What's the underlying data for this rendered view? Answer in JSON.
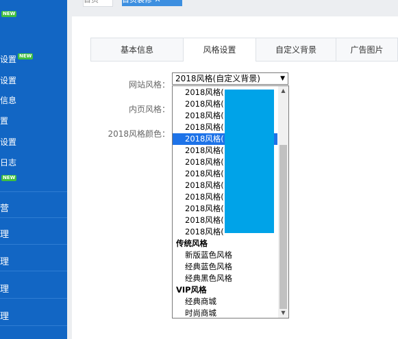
{
  "sidebar": {
    "new_badge": "NEW",
    "items": [
      {
        "label": "设置"
      },
      {
        "label": "设置"
      },
      {
        "label": "信息"
      },
      {
        "label": "置"
      },
      {
        "label": "设置"
      },
      {
        "label": "日志"
      },
      {
        "label": "营"
      },
      {
        "label": "理"
      },
      {
        "label": "理"
      },
      {
        "label": "理"
      },
      {
        "label": "理"
      }
    ]
  },
  "topbar": {
    "home_tab": "首页",
    "active_tab": "首页装修 ✕"
  },
  "tabs": [
    "基本信息",
    "风格设置",
    "自定义背景",
    "广告图片"
  ],
  "form": {
    "site_style_label": "网站风格：",
    "inner_style_label": "内页风格：",
    "color_label": "2018风格颜色：",
    "site_style_value": "2018风格(自定义背景)"
  },
  "dropdown": {
    "options": [
      {
        "label": "2018风格(",
        "group": false,
        "selected": false
      },
      {
        "label": "2018风格(",
        "group": false,
        "selected": false
      },
      {
        "label": "2018风格(",
        "group": false,
        "selected": false
      },
      {
        "label": "2018风格(",
        "group": false,
        "selected": false
      },
      {
        "label": "2018风格(",
        "group": false,
        "selected": true
      },
      {
        "label": "2018风格(",
        "group": false,
        "selected": false
      },
      {
        "label": "2018风格(",
        "group": false,
        "selected": false
      },
      {
        "label": "2018风格(",
        "group": false,
        "selected": false
      },
      {
        "label": "2018风格(",
        "group": false,
        "selected": false
      },
      {
        "label": "2018风格(",
        "group": false,
        "selected": false
      },
      {
        "label": "2018风格(",
        "group": false,
        "selected": false
      },
      {
        "label": "2018风格(",
        "group": false,
        "selected": false
      },
      {
        "label": "2018风格(",
        "group": false,
        "selected": false
      },
      {
        "label": "传统风格",
        "group": true,
        "selected": false
      },
      {
        "label": "新版蓝色风格",
        "group": false,
        "selected": false
      },
      {
        "label": "经典蓝色风格",
        "group": false,
        "selected": false
      },
      {
        "label": "经典黑色风格",
        "group": false,
        "selected": false
      },
      {
        "label": "VIP风格",
        "group": true,
        "selected": false
      },
      {
        "label": "经典商城",
        "group": false,
        "selected": false
      },
      {
        "label": "时尚商城",
        "group": false,
        "selected": false
      }
    ]
  },
  "colors": {
    "sidebar": "#1266c4",
    "selected": "#1e73e8",
    "redaction": "#00a3e8",
    "new_badge": "#3fbf3f"
  }
}
